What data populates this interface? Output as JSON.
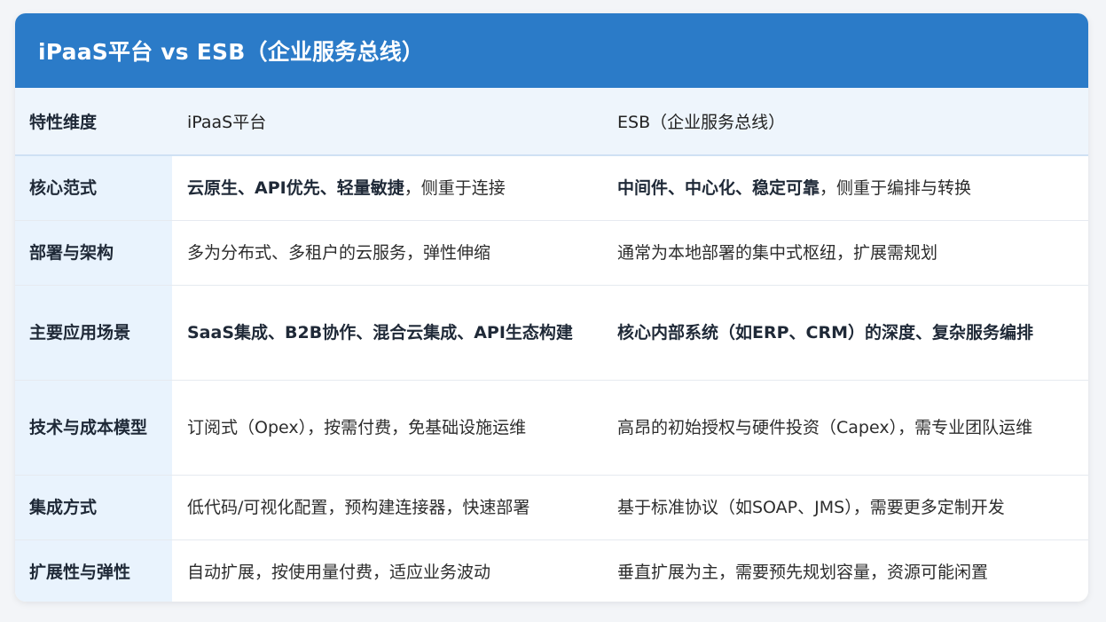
{
  "title": "iPaaS平台 vs ESB（企业服务总线）",
  "header": {
    "col1": "特性维度",
    "col2": "iPaaS平台",
    "col3": "ESB（企业服务总线）"
  },
  "rows": [
    {
      "dim": "核心范式",
      "ipaas": {
        "bold": "云原生、API优先、轻量敏捷",
        "rest": "，侧重于连接"
      },
      "esb": {
        "bold": "中间件、中心化、稳定可靠",
        "rest": "，侧重于编排与转换"
      }
    },
    {
      "dim": "部署与架构",
      "ipaas": {
        "bold": "",
        "rest": "多为分布式、多租户的云服务，弹性伸缩"
      },
      "esb": {
        "bold": "",
        "rest": "通常为本地部署的集中式枢纽，扩展需规划"
      }
    },
    {
      "dim": "主要应用场景",
      "ipaas": {
        "bold": "SaaS集成、B2B协作、混合云集成、API生态构建",
        "rest": ""
      },
      "esb": {
        "bold": "核心内部系统（如ERP、CRM）的深度、复杂服务编排",
        "rest": ""
      }
    },
    {
      "dim": "技术与成本模型",
      "ipaas": {
        "bold": "",
        "rest": "订阅式（Opex），按需付费，免基础设施运维"
      },
      "esb": {
        "bold": "",
        "rest": "高昂的初始授权与硬件投资（Capex），需专业团队运维"
      }
    },
    {
      "dim": "集成方式",
      "ipaas": {
        "bold": "",
        "rest": "低代码/可视化配置，预构建连接器，快速部署"
      },
      "esb": {
        "bold": "",
        "rest": "基于标准协议（如SOAP、JMS），需要更多定制开发"
      }
    },
    {
      "dim": "扩展性与弹性",
      "ipaas": {
        "bold": "",
        "rest": "自动扩展，按使用量付费，适应业务波动"
      },
      "esb": {
        "bold": "",
        "rest": "垂直扩展为主，需要预先规划容量，资源可能闲置"
      }
    }
  ]
}
